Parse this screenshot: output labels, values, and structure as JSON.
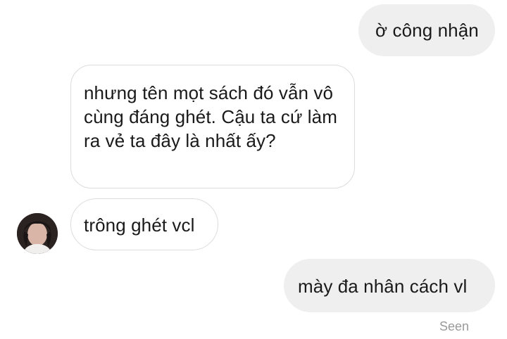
{
  "messages": [
    {
      "id": "msg1",
      "direction": "outgoing",
      "text": "ờ công nhận"
    },
    {
      "id": "msg2",
      "direction": "incoming",
      "text": "nhưng tên mọt sách đó vẫn vô cùng đáng ghét. Cậu ta cứ làm ra vẻ ta đây là nhất ấy?"
    },
    {
      "id": "msg3",
      "direction": "incoming",
      "text": "trông ghét vcl"
    },
    {
      "id": "msg4",
      "direction": "outgoing",
      "text": "mày đa nhân cách vl"
    }
  ],
  "status": {
    "seen_label": "Seen"
  },
  "colors": {
    "outgoing_bubble": "#efefef",
    "incoming_border": "#dcdcdc",
    "text": "#1a1a1a",
    "seen_text": "#9a9a9a"
  },
  "icons": {
    "contact_avatar": "profile-photo"
  }
}
